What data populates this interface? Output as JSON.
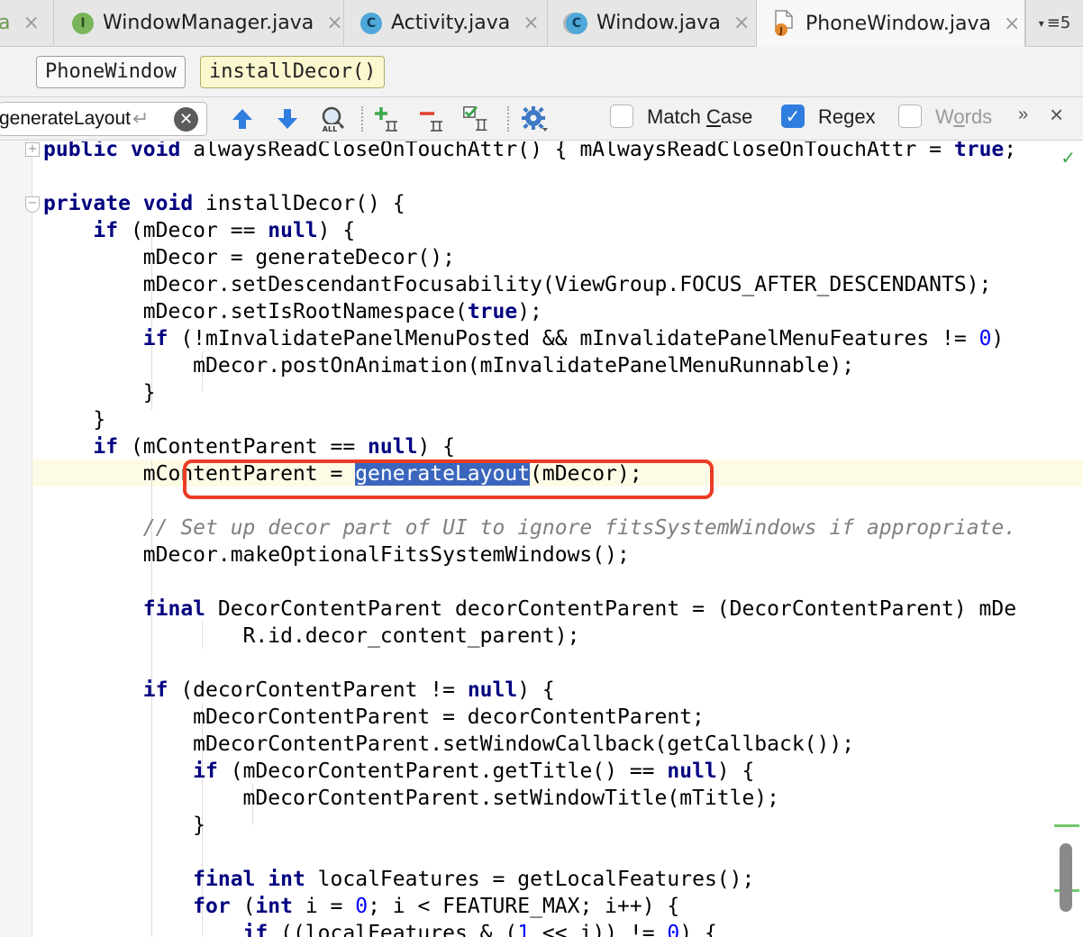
{
  "tabs": [
    {
      "label": "a",
      "icon": "java-file-icon",
      "close": "×"
    },
    {
      "label": "WindowManager.java",
      "icon": "interface-icon",
      "icon_letter": "I",
      "close": "×"
    },
    {
      "label": "Activity.java",
      "icon": "class-icon",
      "icon_letter": "C",
      "close": "×"
    },
    {
      "label": "Window.java",
      "icon": "class-icon",
      "icon_letter": "C",
      "close": "×"
    },
    {
      "label": "PhoneWindow.java",
      "icon": "java-file-icon",
      "close": "×",
      "active": true
    }
  ],
  "tab_overflow": {
    "label": "≡5",
    "icon": "chevron-down-icon"
  },
  "breadcrumb": [
    "PhoneWindow",
    "installDecor()"
  ],
  "search": {
    "query": "generateLayout",
    "history_icon": "↵",
    "clear_icon": "✕",
    "options": {
      "match_case": {
        "before": "Match ",
        "under": "C",
        "after": "ase",
        "checked": false
      },
      "regex": {
        "before": "Re",
        "under": "g",
        "after": "ex",
        "checked": true
      },
      "words": {
        "before": "W",
        "under": "o",
        "after": "rds",
        "checked": false
      }
    },
    "more": "»",
    "close": "×"
  },
  "editor": {
    "lines": [
      "public void alwaysReadCloseOnTouchAttr() { mAlwaysReadCloseOnTouchAttr = true;",
      "",
      "private void installDecor() {",
      "    if (mDecor == null) {",
      "        mDecor = generateDecor();",
      "        mDecor.setDescendantFocusability(ViewGroup.FOCUS_AFTER_DESCENDANTS);",
      "        mDecor.setIsRootNamespace(true);",
      "        if (!mInvalidatePanelMenuPosted && mInvalidatePanelMenuFeatures != 0)",
      "            mDecor.postOnAnimation(mInvalidatePanelMenuRunnable);",
      "        }",
      "    }",
      "    if (mContentParent == null) {",
      "        mContentParent = generateLayout(mDecor);",
      "",
      "        // Set up decor part of UI to ignore fitsSystemWindows if appropriate.",
      "        mDecor.makeOptionalFitsSystemWindows();",
      "",
      "        final DecorContentParent decorContentParent = (DecorContentParent) mDe",
      "                R.id.decor_content_parent);",
      "",
      "        if (decorContentParent != null) {",
      "            mDecorContentParent = decorContentParent;",
      "            mDecorContentParent.setWindowCallback(getCallback());",
      "            if (mDecorContentParent.getTitle() == null) {",
      "                mDecorContentParent.setWindowTitle(mTitle);",
      "            }",
      "",
      "            final int localFeatures = getLocalFeatures();",
      "            for (int i = 0; i < FEATURE_MAX; i++) {",
      "                if ((localFeatures & (1 << i)) != 0) {"
    ],
    "highlighted_match": "generateLayout",
    "highlight_color": "#ec3b25",
    "keyword_color": "#000080"
  }
}
